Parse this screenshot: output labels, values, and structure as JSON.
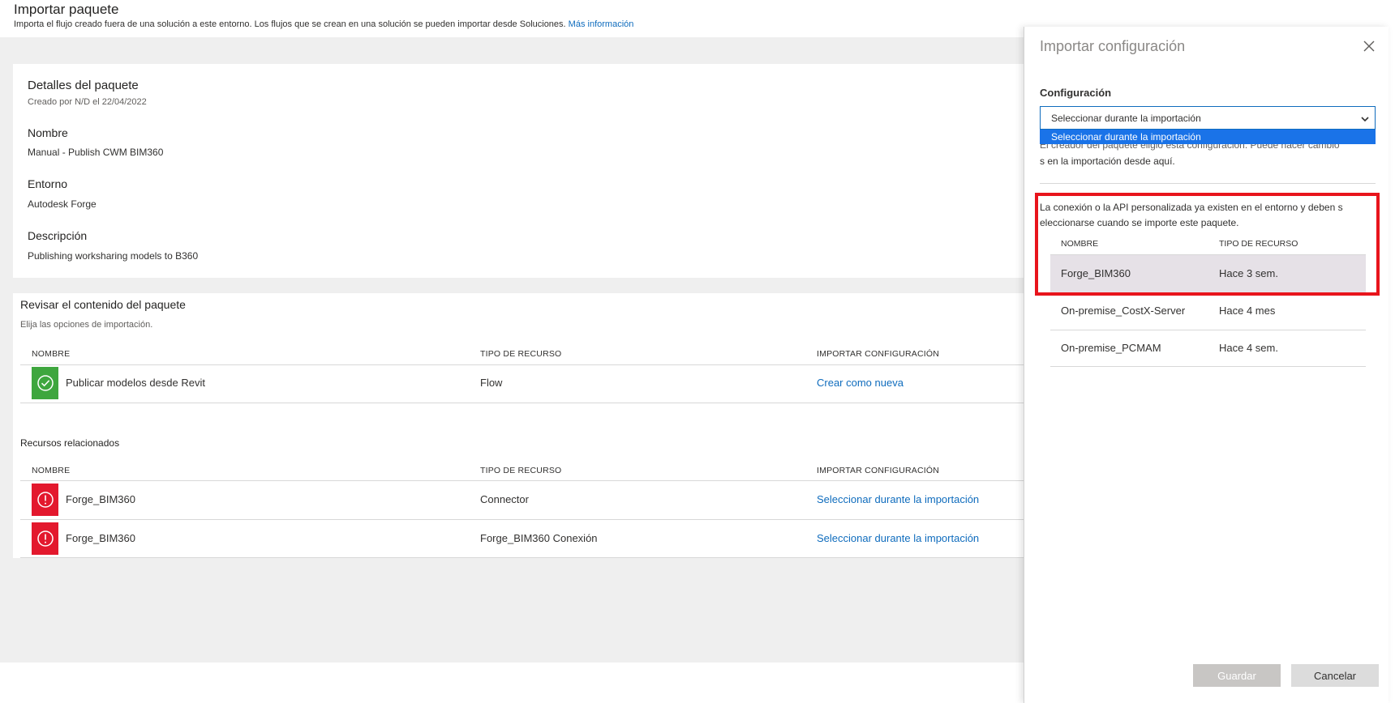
{
  "page": {
    "title": "Importar paquete",
    "subtitle": "Importa el flujo creado fuera de una solución a este entorno. Los flujos que se crean en una solución se pueden importar desde Soluciones.",
    "more_info_link": "Más información"
  },
  "details": {
    "heading": "Detalles del paquete",
    "created_by": "Creado por N/D el 22/04/2022",
    "fields": [
      {
        "label": "Nombre",
        "value": "Manual - Publish CWM BIM360"
      },
      {
        "label": "Entorno",
        "value": "Autodesk Forge"
      },
      {
        "label": "Descripción",
        "value": "Publishing worksharing models to B360"
      }
    ]
  },
  "review": {
    "title": "Revisar el contenido del paquete",
    "subtitle": "Elija las opciones de importación.",
    "columns": [
      "NOMBRE",
      "TIPO DE RECURSO",
      "IMPORTAR CONFIGURACIÓN"
    ],
    "rows": [
      {
        "name": "Publicar modelos desde Revit",
        "type": "Flow",
        "action": "Crear como nueva",
        "status": "ok"
      }
    ]
  },
  "related": {
    "title": "Recursos relacionados",
    "columns": [
      "NOMBRE",
      "TIPO DE RECURSO",
      "IMPORTAR CONFIGURACIÓN"
    ],
    "rows": [
      {
        "name": "Forge_BIM360",
        "type": "Connector",
        "action": "Seleccionar durante la importación",
        "status": "error"
      },
      {
        "name": "Forge_BIM360",
        "type": "Forge_BIM360 Conexión",
        "action": "Seleccionar durante la importación",
        "status": "error"
      }
    ]
  },
  "panel": {
    "title": "Importar configuración",
    "config_label": "Configuración",
    "select_value": "Seleccionar durante la importación",
    "dropdown_option": "Seleccionar durante la importación",
    "desc_line1": "El creador del paquete eligió esta configuración. Puede hacer cambio",
    "desc_line2": "s en la importación desde aquí.",
    "info_line1": "La conexión o la API personalizada ya existen en el entorno y deben s",
    "info_line2": "eleccionarse cuando se importe este paquete.",
    "columns": [
      "NOMBRE",
      "TIPO DE RECURSO"
    ],
    "rows": [
      {
        "name": "Forge_BIM360",
        "type": "Hace 3 sem.",
        "selected": true
      },
      {
        "name": "On-premise_CostX-Server",
        "type": "Hace 4 mes",
        "selected": false
      },
      {
        "name": "On-premise_PCMAM",
        "type": "Hace 4 sem.",
        "selected": false
      }
    ],
    "save_label": "Guardar",
    "cancel_label": "Cancelar"
  },
  "colors": {
    "accent": "#0f6cbd",
    "ok": "#3ea63e",
    "error": "#e3182d",
    "highlight": "#e8141c",
    "selected_row": "#e6e1e7"
  }
}
